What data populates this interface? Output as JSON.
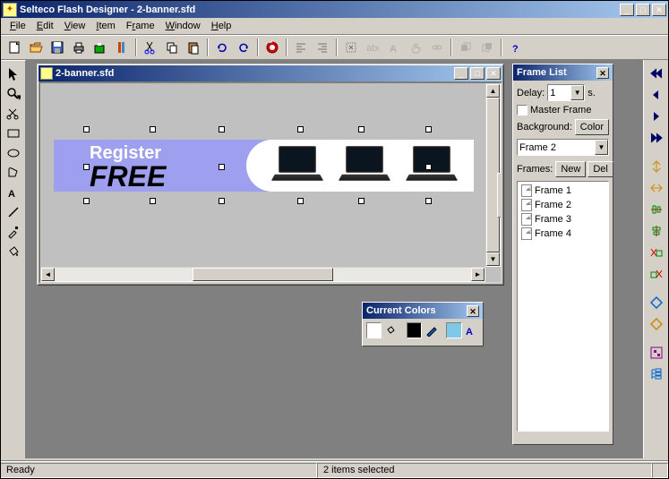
{
  "app": {
    "title": "Selteco Flash Designer - 2-banner.sfd"
  },
  "menu": {
    "file": "File",
    "edit": "Edit",
    "view": "View",
    "item": "Item",
    "frame": "Frame",
    "window": "Window",
    "help": "Help"
  },
  "document": {
    "title": "2-banner.sfd"
  },
  "banner": {
    "line1": "Register",
    "line2": "FREE"
  },
  "framepanel": {
    "title": "Frame List",
    "delay_label": "Delay:",
    "delay_value": "1",
    "delay_unit": "s.",
    "master_label": "Master Frame",
    "background_label": "Background:",
    "color_btn": "Color",
    "selected_frame": "Frame 2",
    "frames_label": "Frames:",
    "new_btn": "New",
    "del_btn": "Del",
    "frames": [
      "Frame 1",
      "Frame 2",
      "Frame 3",
      "Frame 4"
    ]
  },
  "colorpanel": {
    "title": "Current Colors"
  },
  "status": {
    "ready": "Ready",
    "selection": "2 items selected"
  }
}
